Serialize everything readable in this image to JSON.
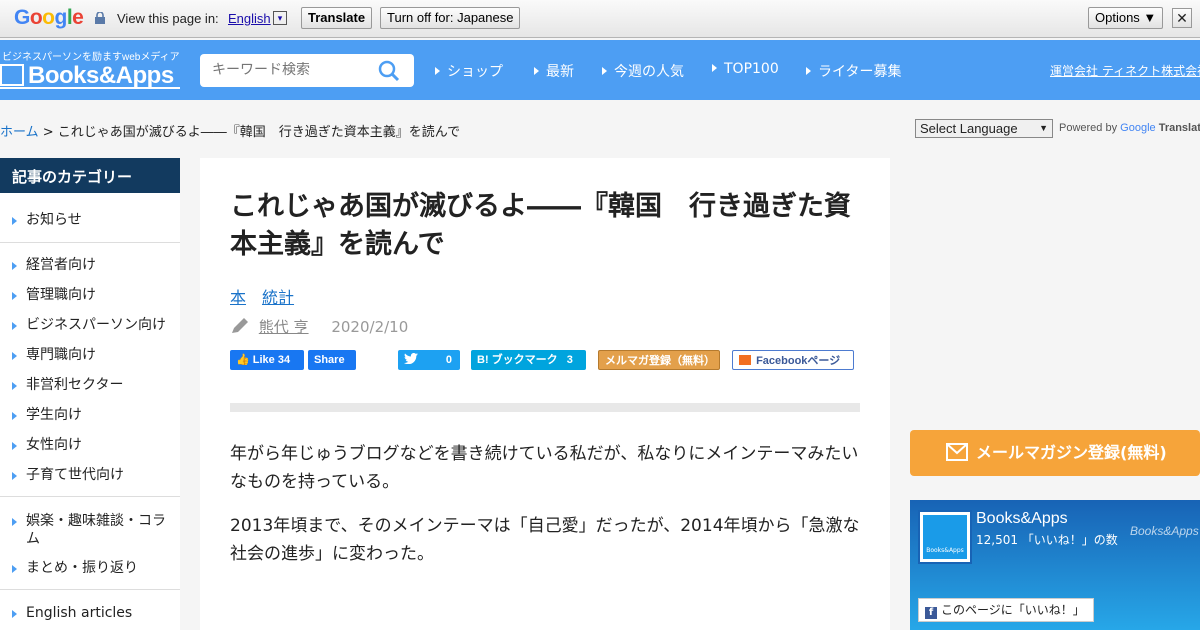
{
  "translate_bar": {
    "logo": "Google",
    "view_label": "View this page in:",
    "language": "English",
    "dropdown": "▾",
    "translate_button": "Translate",
    "turn_off_button": "Turn off for: Japanese",
    "options_button": "Options ▼",
    "close": "✕"
  },
  "header": {
    "tagline": "ビジネスパーソンを励ますwebメディア",
    "logo_text": "Books&Apps",
    "search_placeholder": "キーワード検索",
    "nav": [
      "ショップ",
      "最新",
      "今週の人気",
      "TOP100",
      "ライター募集"
    ],
    "company_link": "運営会社 ティネクト株式会社"
  },
  "breadcrumb": {
    "home": "ホーム",
    "separator": " > ",
    "current": "これじゃあ国が滅びるよ――『韓国　行き過ぎた資本主義』を読んで"
  },
  "language_select": {
    "selected": "Select Language",
    "arrow": "▼",
    "powered_by": "Powered by",
    "google": "Google",
    "translate": "Translate"
  },
  "sidebar": {
    "heading": "記事のカテゴリー",
    "items": [
      "お知らせ",
      "経営者向け",
      "管理職向け",
      "ビジネスパーソン向け",
      "専門職向け",
      "非営利セクター",
      "学生向け",
      "女性向け",
      "子育て世代向け",
      "娯楽・趣味雑談・コラム",
      "まとめ・振り返り",
      "English articles"
    ]
  },
  "article": {
    "title": "これじゃあ国が滅びるよ――『韓国　行き過ぎた資本主義』を読んで",
    "tags": [
      "本",
      "統計"
    ],
    "author": "熊代 亨",
    "date": "2020/2/10",
    "social": {
      "like": "Like",
      "like_count": "34",
      "share": "Share",
      "tweet_count": "0",
      "hatena_label": "B! ブックマーク",
      "hatena_count": "3",
      "mailmag": "メルマガ登録（無料）",
      "facebook_page": "Facebookページ"
    },
    "paragraphs": [
      "年がら年じゅうブログなどを書き続けている私だが、私なりにメインテーマみたいなものを持っている。",
      "2013年頃まで、そのメインテーマは「自己愛」だったが、2014年頃から「急激な社会の進歩」に変わった。"
    ]
  },
  "right": {
    "mail_cta": "メールマガジン登録(無料)",
    "fb_name": "Books&Apps",
    "fb_likes": "12,501 「いいね！」の数",
    "fb_watermark": "Books&Apps",
    "fb_logo_text": "Books&Apps",
    "fb_like_button": "このページに「いいね！」"
  },
  "colors": {
    "header_blue": "#4d9ef3",
    "sidebar_head": "#123a5f",
    "cta_orange": "#f6a43a",
    "link_blue": "#1a73c9"
  }
}
